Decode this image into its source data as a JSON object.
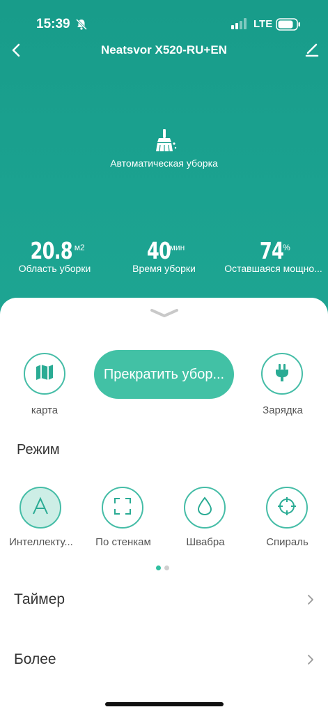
{
  "status_bar": {
    "time": "15:39",
    "network": "LTE",
    "icons": [
      "bell-muted-icon",
      "signal-icon",
      "battery-icon"
    ]
  },
  "header": {
    "title": "Neatsvor X520-RU+EN",
    "back_icon": "chevron-left-icon",
    "edit_icon": "pencil-icon"
  },
  "current_mode": {
    "icon": "broom-icon",
    "label": "Автоматическая уборка"
  },
  "stats": [
    {
      "value": "20.8",
      "unit": "м2",
      "label": "Область уборки"
    },
    {
      "value": "40",
      "unit": "мин",
      "label": "Время уборки"
    },
    {
      "value": "74",
      "unit": "%",
      "label": "Оставшаяся мощно..."
    }
  ],
  "actions": {
    "map_label": "карта",
    "stop_label": "Прекратить убор...",
    "charge_label": "Зарядка"
  },
  "modes": {
    "title": "Режим",
    "items": [
      {
        "label": "Интеллекту...",
        "icon": "letter-a-icon",
        "active": true
      },
      {
        "label": "По стенкам",
        "icon": "edge-frame-icon",
        "active": false
      },
      {
        "label": "Швабра",
        "icon": "water-drop-icon",
        "active": false
      },
      {
        "label": "Спираль",
        "icon": "spiral-target-icon",
        "active": false
      }
    ],
    "pages": 2,
    "current_page": 1
  },
  "rows": [
    {
      "label": "Таймер"
    },
    {
      "label": "Более"
    }
  ],
  "colors": {
    "header_bg": "#1ba08e",
    "accent": "#42c1a5",
    "outline": "#46bda7",
    "active_fill": "#cdeee6"
  }
}
